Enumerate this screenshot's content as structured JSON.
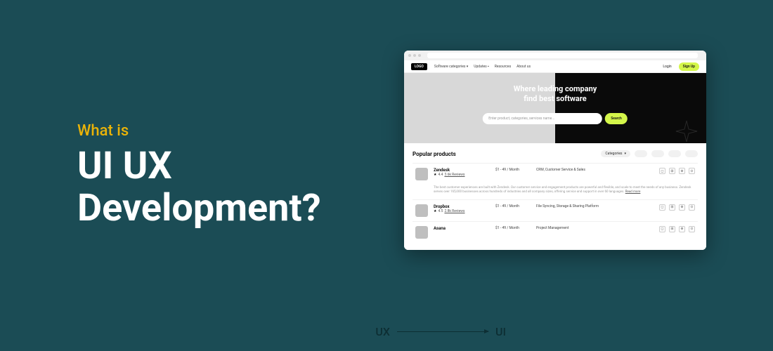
{
  "left": {
    "eyebrow": "What is",
    "headline_1": "UI UX",
    "headline_2": "Development?"
  },
  "mockup": {
    "logo": "LOGO",
    "nav": {
      "cat": "Software categories",
      "upd": "Updates",
      "res": "Resources",
      "about": "About us"
    },
    "auth": {
      "login": "Login",
      "signup": "Sign Up"
    },
    "hero": {
      "title_1": "Where leading company",
      "title_2": "find best software",
      "search_placeholder": "Enter product, categories, services name...",
      "search_btn": "Search"
    },
    "section": {
      "title": "Popular products",
      "categories": "Categories"
    },
    "products": [
      {
        "name": "Zendesk",
        "rating": "4.4",
        "reviews": "3.6k Reviews",
        "price": "$1 - 49 / Month",
        "category": "CRM, Customer Service & Sales"
      },
      {
        "name": "Dropbox",
        "rating": "4.5",
        "reviews": "2.8k Reviews",
        "price": "$1 - 49 / Month",
        "category": "File Syncing, Storage & Sharing Platform"
      },
      {
        "name": "Asana",
        "rating": "",
        "reviews": "",
        "price": "$1 - 49 / Month",
        "category": "Project Management"
      }
    ],
    "desc": "The best customer experiences are built with Zendesk. Our customer service and engagement products are powerful and flexible, and scale to meet the needs of any business. Zendesk serves over 165,000 businesses across hundreds of industries and all company sizes, offering service and support in over 60 languages.",
    "readmore": "Read more"
  },
  "footer": {
    "ux": "UX",
    "ui": "UI"
  }
}
